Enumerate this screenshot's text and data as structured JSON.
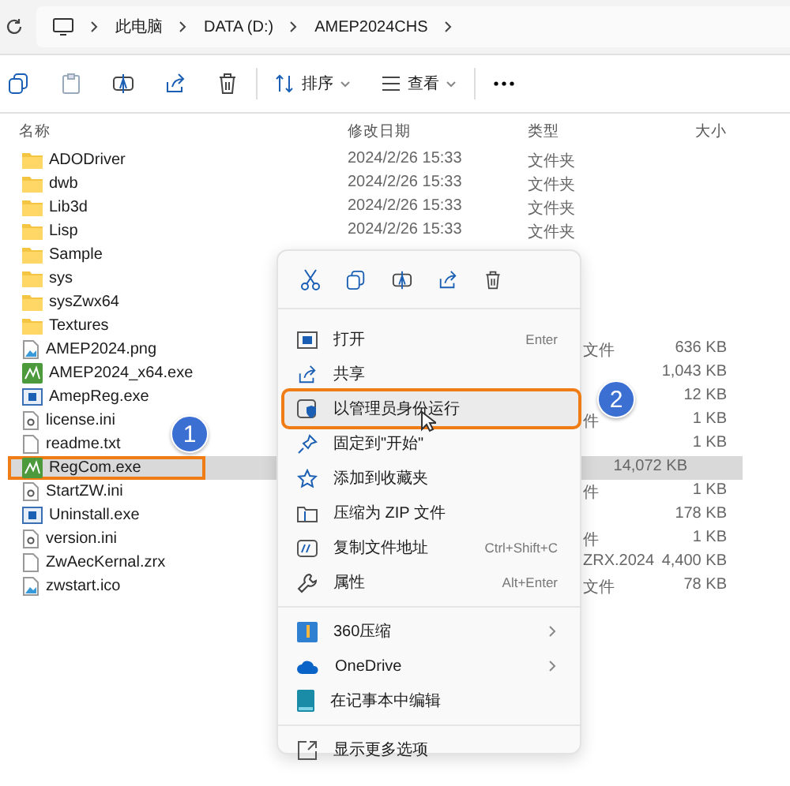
{
  "breadcrumb": [
    "此电脑",
    "DATA (D:)",
    "AMEP2024CHS"
  ],
  "toolbar": {
    "sort": "排序",
    "view": "查看"
  },
  "columns": [
    "名称",
    "修改日期",
    "类型",
    "大小"
  ],
  "files": [
    {
      "name": "ADODriver",
      "kind": "folder",
      "date": "2024/2/26 15:33",
      "type": "文件夹",
      "selected": false,
      "highlighted": false
    },
    {
      "name": "dwb",
      "kind": "folder",
      "date": "2024/2/26 15:33",
      "type": "文件夹",
      "selected": false,
      "highlighted": false
    },
    {
      "name": "Lib3d",
      "kind": "folder",
      "date": "2024/2/26 15:33",
      "type": "文件夹",
      "selected": false,
      "highlighted": false
    },
    {
      "name": "Lisp",
      "kind": "folder",
      "date": "2024/2/26 15:33",
      "type": "文件夹",
      "selected": false,
      "highlighted": false
    },
    {
      "name": "Sample",
      "kind": "folder",
      "selected": false,
      "highlighted": false
    },
    {
      "name": "sys",
      "kind": "folder",
      "selected": false,
      "highlighted": false
    },
    {
      "name": "sysZwx64",
      "kind": "folder",
      "selected": false,
      "highlighted": false
    },
    {
      "name": "Textures",
      "kind": "folder",
      "selected": false,
      "highlighted": false
    },
    {
      "name": "AMEP2024.png",
      "kind": "image",
      "type": "文件",
      "size": "636 KB",
      "selected": false,
      "highlighted": false
    },
    {
      "name": "AMEP2024_x64.exe",
      "kind": "app",
      "size": "1,043 KB",
      "selected": false,
      "highlighted": false
    },
    {
      "name": "AmepReg.exe",
      "kind": "window",
      "size": "12 KB",
      "selected": false,
      "highlighted": false
    },
    {
      "name": "license.ini",
      "kind": "settings",
      "type": "件",
      "size": "1 KB",
      "selected": false,
      "highlighted": false
    },
    {
      "name": "readme.txt",
      "kind": "text",
      "size": "1 KB",
      "selected": false,
      "highlighted": false
    },
    {
      "name": "RegCom.exe",
      "kind": "app",
      "size": "14,072 KB",
      "selected": true,
      "highlighted": true
    },
    {
      "name": "StartZW.ini",
      "kind": "settings",
      "type": "件",
      "size": "1 KB",
      "selected": false,
      "highlighted": false
    },
    {
      "name": "Uninstall.exe",
      "kind": "window",
      "size": "178 KB",
      "selected": false,
      "highlighted": false
    },
    {
      "name": "version.ini",
      "kind": "settings",
      "type": "件",
      "size": "1 KB",
      "selected": false,
      "highlighted": false
    },
    {
      "name": "ZwAecKernal.zrx",
      "kind": "text",
      "type": "ZRX.2024",
      "size": "4,400 KB",
      "selected": false,
      "highlighted": false
    },
    {
      "name": "zwstart.ico",
      "kind": "image",
      "type": "文件",
      "size": "78 KB",
      "selected": false,
      "highlighted": false
    }
  ],
  "menu": {
    "groups": [
      [
        {
          "label": "打开",
          "shortcut": "Enter",
          "selected": false,
          "highlighted": false,
          "submenu": false
        },
        {
          "label": "共享",
          "selected": false,
          "highlighted": false,
          "submenu": false
        },
        {
          "label": "以管理员身份运行",
          "selected": true,
          "highlighted": true,
          "submenu": false
        },
        {
          "label": "固定到\"开始\"",
          "selected": false,
          "highlighted": false,
          "submenu": false
        },
        {
          "label": "添加到收藏夹",
          "selected": false,
          "highlighted": false,
          "submenu": false
        },
        {
          "label": "压缩为 ZIP 文件",
          "selected": false,
          "highlighted": false,
          "submenu": false
        },
        {
          "label": "复制文件地址",
          "shortcut": "Ctrl+Shift+C",
          "selected": false,
          "highlighted": false,
          "submenu": false
        },
        {
          "label": "属性",
          "shortcut": "Alt+Enter",
          "selected": false,
          "highlighted": false,
          "submenu": false
        }
      ],
      [
        {
          "label": "360压缩",
          "selected": false,
          "highlighted": false,
          "submenu": true
        },
        {
          "label": "OneDrive",
          "selected": false,
          "highlighted": false,
          "submenu": true
        },
        {
          "label": "在记事本中编辑",
          "selected": false,
          "highlighted": false,
          "submenu": false
        }
      ],
      [
        {
          "label": "显示更多选项",
          "selected": false,
          "highlighted": false,
          "submenu": false
        }
      ]
    ]
  },
  "callouts": [
    "1",
    "2"
  ]
}
